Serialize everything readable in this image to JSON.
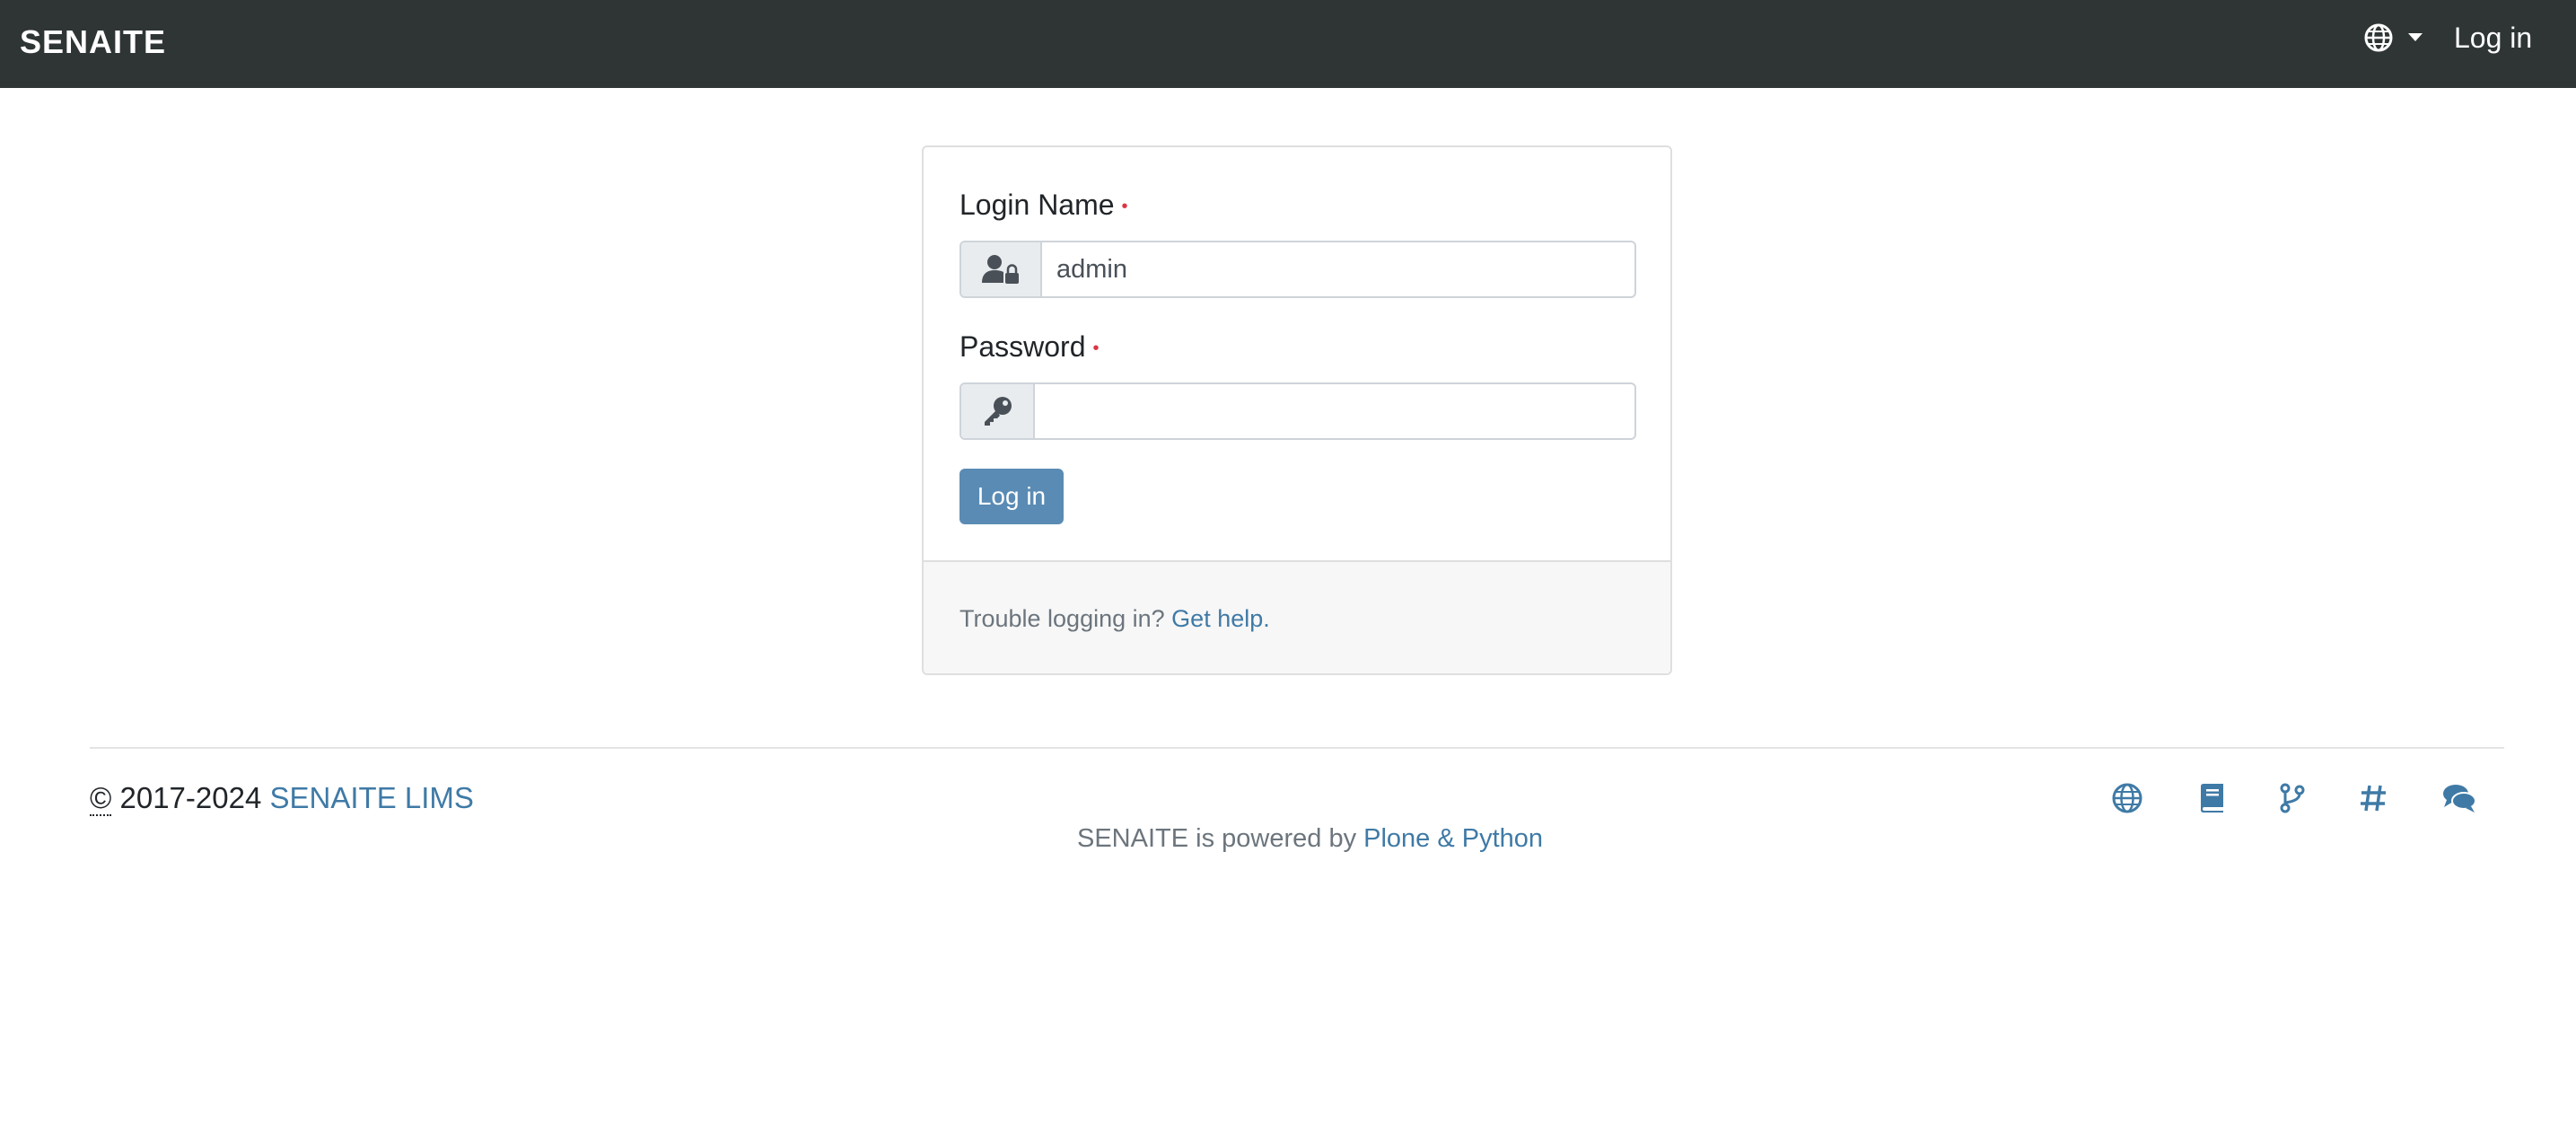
{
  "navbar": {
    "brand": "SENAITE",
    "language_icon": "globe-icon",
    "login_label": "Log in"
  },
  "login_form": {
    "login_name_label": "Login Name",
    "login_name_value": "admin",
    "login_name_icon": "user-lock-icon",
    "password_label": "Password",
    "password_value": "",
    "password_icon": "key-icon",
    "required_marker": "•",
    "submit_label": "Log in"
  },
  "help": {
    "text": "Trouble logging in?",
    "link_label": "Get help."
  },
  "footer": {
    "copyright_symbol": "©",
    "copyright_years": "2017-2024",
    "copyright_link": "SENAITE LIMS",
    "powered_text": "SENAITE is powered by",
    "powered_link": "Plone & Python",
    "icons": [
      "globe-icon",
      "book-icon",
      "code-branch-icon",
      "hashtag-icon",
      "comments-icon"
    ]
  },
  "colors": {
    "navbar_bg": "#2f3535",
    "accent": "#5a8bb4",
    "link": "#3f7aa6",
    "required": "#dc3545"
  }
}
